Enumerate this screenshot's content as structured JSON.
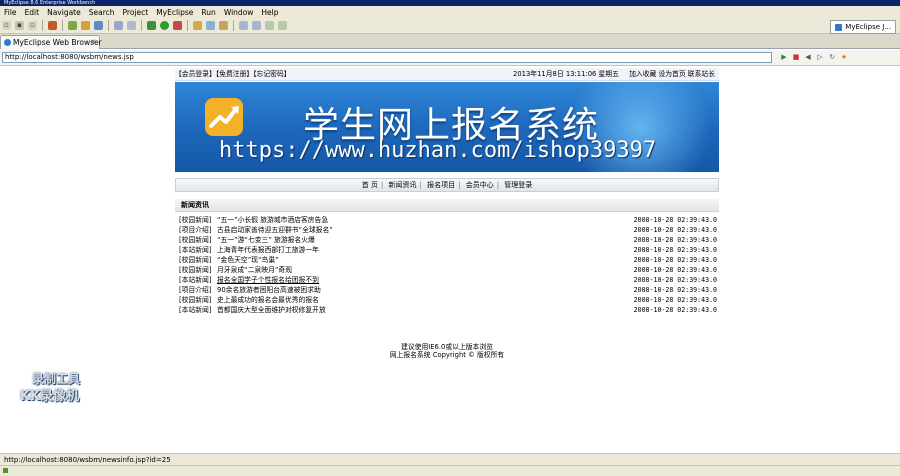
{
  "window": {
    "title": "MyEclipse 8.6 Enterprise Workbench"
  },
  "menu": [
    "File",
    "Edit",
    "Navigate",
    "Search",
    "Project",
    "MyEclipse",
    "Run",
    "Window",
    "Help"
  ],
  "perspective": {
    "label": "MyEclipse J..."
  },
  "tab": {
    "label": "MyEclipse Web Browser",
    "close": "✕"
  },
  "url": {
    "value": "http://localhost:8080/wsbm/news.jsp"
  },
  "site": {
    "topbar": {
      "left": "【会员登录】【免费注册】【忘记密码】",
      "date": "2013年11月8日 13:11:06  星期五",
      "right": "加入收藏  设为首页  联系站长"
    },
    "banner": {
      "title": "学生网上报名系统",
      "watermark": "https://www.huzhan.com/ishop39397"
    },
    "nav": [
      "首 页",
      "新闻资讯",
      "报名项目",
      "会员中心",
      "管理登录"
    ],
    "news_header": "新闻资讯",
    "news": [
      {
        "cat": "[校园新闻]",
        "title": "“五一”小长假 旅游城市酒店客房告急",
        "time": "2008-10-28 02:39:43.0"
      },
      {
        "cat": "[项目介绍]",
        "title": "古县启动家善待迎五迎群书“全球报名”",
        "time": "2008-10-28 02:39:43.0"
      },
      {
        "cat": "[校园新闻]",
        "title": "“五一”游“七变三” 旅游报名火爆",
        "time": "2008-10-28 02:39:43.0"
      },
      {
        "cat": "[本站新闻]",
        "title": "上海青年代表报西部打工旅游一年",
        "time": "2008-10-28 02:39:43.0"
      },
      {
        "cat": "[校园新闻]",
        "title": "“金色天空”现“鸟巢”",
        "time": "2008-10-28 02:39:43.0"
      },
      {
        "cat": "[校园新闻]",
        "title": "月牙泉成“二泉映月”奇观",
        "time": "2008-10-28 02:39:43.0"
      },
      {
        "cat": "[本站新闻]",
        "title": "报名全国学子个性报名给团报不到",
        "time": "2008-10-28 02:39:43.0"
      },
      {
        "cat": "[项目介绍]",
        "title": "90余名旅游者困阳台高速被困求助",
        "time": "2008-10-28 02:39:43.0"
      },
      {
        "cat": "[校园新闻]",
        "title": "史上最成功的报名会最优秀的报名",
        "time": "2008-10-28 02:39:43.0"
      },
      {
        "cat": "[本站新闻]",
        "title": "首都国庆大型全面维护对权修复开放",
        "time": "2008-10-28 02:39:43.0"
      }
    ],
    "footer": [
      "建议使用IE6.0或以上版本浏览",
      "网上报名系统 Copyright © 版权所有"
    ]
  },
  "badge": {
    "line1": "录制工具",
    "line2": "KK录像机"
  },
  "status": {
    "text": "http://localhost:8080/wsbm/newsinfo.jsp?id=25"
  }
}
